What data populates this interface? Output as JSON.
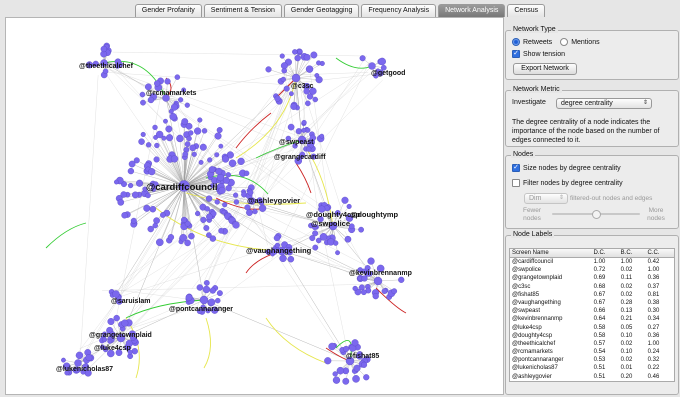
{
  "tabs": [
    {
      "label": "Gender Profanity",
      "active": false
    },
    {
      "label": "Sentiment & Tension",
      "active": false
    },
    {
      "label": "Gender Geotagging",
      "active": false
    },
    {
      "label": "Frequency Analysis",
      "active": false
    },
    {
      "label": "Network Analysis",
      "active": true
    },
    {
      "label": "Census",
      "active": false
    }
  ],
  "network_type": {
    "title": "Network Type",
    "retweets_label": "Retweets",
    "mentions_label": "Mentions",
    "show_tension_label": "Show tension",
    "export_label": "Export Network",
    "selected": "Retweets",
    "show_tension": true
  },
  "network_metric": {
    "title": "Network Metric",
    "investigate_label": "Investigate",
    "selected_metric": "degree centrality",
    "description": "The degree centrality of a node indicates the importance of the node based on the number of edges connected to it."
  },
  "nodes_panel": {
    "title": "Nodes",
    "size_label": "Size nodes by degree centrality",
    "size_checked": true,
    "filter_label": "Filter nodes by degree centrality",
    "filter_checked": false,
    "dim_value": "Dim",
    "dim_suffix": "filtered-out nodes and edges",
    "fewer_label": "Fewer nodes",
    "more_label": "More nodes",
    "slider_value": 0.5
  },
  "node_labels": {
    "title": "Node Labels",
    "columns": [
      "Screen Name",
      "D.C.",
      "B.C.",
      "C.C."
    ],
    "rows": [
      [
        "@cardiffcouncil",
        "1.00",
        "1.00",
        "0.42"
      ],
      [
        "@swpolice",
        "0.72",
        "0.02",
        "1.00"
      ],
      [
        "@grangetownplaid",
        "0.69",
        "0.11",
        "0.36"
      ],
      [
        "@c3sc",
        "0.68",
        "0.02",
        "0.37"
      ],
      [
        "@fishat85",
        "0.67",
        "0.02",
        "0.81"
      ],
      [
        "@vaughangething",
        "0.67",
        "0.28",
        "0.38"
      ],
      [
        "@swpeast",
        "0.66",
        "0.13",
        "0.30"
      ],
      [
        "@kevinbrennanmp",
        "0.64",
        "0.21",
        "0.34"
      ],
      [
        "@luke4csp",
        "0.58",
        "0.05",
        "0.27"
      ],
      [
        "@doughty4csp",
        "0.58",
        "0.10",
        "0.36"
      ],
      [
        "@theethicalchef",
        "0.57",
        "0.02",
        "1.00"
      ],
      [
        "@rcmamarkets",
        "0.54",
        "0.10",
        "0.24"
      ],
      [
        "@pontcannaranger",
        "0.53",
        "0.02",
        "0.32"
      ],
      [
        "@lukenicholas87",
        "0.51",
        "0.01",
        "0.22"
      ],
      [
        "@ashleygovier",
        "0.51",
        "0.20",
        "0.46"
      ]
    ]
  },
  "graph_labels": {
    "theethicalchef": "@theethicalchef",
    "rcmamarkets": "@rcmamarkets",
    "c3sc": "@c3sc",
    "getgood": "@getgood",
    "swpeast": "@swpeast",
    "grangecardiff": "@grangecardiff",
    "cardiffcouncil": "@cardiffcouncil",
    "ashleygovier": "@ashleygovier",
    "doughty4csp": "@doughty4csp",
    "doughtymp": "@doughtymp",
    "swpolice": "@swpolice",
    "vaughangething": "@vaughangething",
    "kevinbrennanmp": "@kevinbrennanmp",
    "saruislam": "@saruislam",
    "pontcannaranger": "@pontcannaranger",
    "grangetownplaid": "@grangetownplaid",
    "luke4csp": "@luke4csp",
    "lukenicholas87": "@lukenicholas87",
    "fishat85": "@fishat85"
  },
  "colors": {
    "node": "#7b68ee",
    "edge": "#9a9a9a",
    "retweet_edge": "#33cc33",
    "tension_edge": "#e6e64d",
    "mention_edge": "#cc2222",
    "active_tab": "#878787",
    "check": "#2f6fe0"
  }
}
